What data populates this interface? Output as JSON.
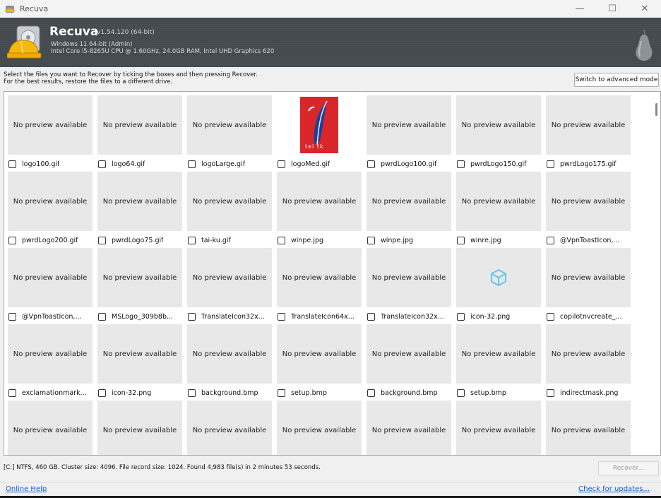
{
  "window": {
    "title": "Recuva",
    "minimize_glyph": "—",
    "maximize_glyph": "☐",
    "close_glyph": "✕"
  },
  "header": {
    "app_name": "Recuva",
    "version": "v1.54.120 (64-bit)",
    "os": "Windows 11 64-bit (Admin)",
    "hardware": "Intel Core i5-8265U CPU @ 1.60GHz, 24.0GB RAM, Intel UHD Graphics 620"
  },
  "instructions": {
    "line1": "Select the files you want to Recover by ticking the boxes and then pressing Recover.",
    "line2": "For the best results, restore the files to a different drive."
  },
  "advanced_button_label": "Switch to advanced mode",
  "no_preview_text": "No preview available",
  "image_thumb_text": "tel tk",
  "files": [
    {
      "name": "logo100.gif",
      "preview": "none"
    },
    {
      "name": "logo64.gif",
      "preview": "none"
    },
    {
      "name": "logoLarge.gif",
      "preview": "none"
    },
    {
      "name": "logoMed.gif",
      "preview": "feather"
    },
    {
      "name": "pwrdLogo100.gif",
      "preview": "none"
    },
    {
      "name": "pwrdLogo150.gif",
      "preview": "none"
    },
    {
      "name": "pwrdLogo175.gif",
      "preview": "none"
    },
    {
      "name": "pwrdLogo200.gif",
      "preview": "none"
    },
    {
      "name": "pwrdLogo75.gif",
      "preview": "none"
    },
    {
      "name": "tai-ku.gif",
      "preview": "none"
    },
    {
      "name": "winpe.jpg",
      "preview": "none"
    },
    {
      "name": "winpe.jpg",
      "preview": "none"
    },
    {
      "name": "winre.jpg",
      "preview": "none"
    },
    {
      "name": "@VpnToastIcon,...",
      "preview": "none"
    },
    {
      "name": "@VpnToastIcon,...",
      "preview": "none"
    },
    {
      "name": "MSLogo_309b8b...",
      "preview": "none"
    },
    {
      "name": "TranslateIcon32x...",
      "preview": "none"
    },
    {
      "name": "TranslateIcon64x...",
      "preview": "none"
    },
    {
      "name": "TranslateIcon32x...",
      "preview": "none"
    },
    {
      "name": "icon-32.png",
      "preview": "cube"
    },
    {
      "name": "copilotnvcreate_...",
      "preview": "none"
    },
    {
      "name": "exclamationmark...",
      "preview": "none"
    },
    {
      "name": "icon-32.png",
      "preview": "none"
    },
    {
      "name": "background.bmp",
      "preview": "none"
    },
    {
      "name": "setup.bmp",
      "preview": "none"
    },
    {
      "name": "background.bmp",
      "preview": "none"
    },
    {
      "name": "setup.bmp",
      "preview": "none"
    },
    {
      "name": "indirectmask.png",
      "preview": "none"
    },
    {
      "name": "",
      "preview": "none"
    },
    {
      "name": "",
      "preview": "none"
    },
    {
      "name": "",
      "preview": "none"
    },
    {
      "name": "",
      "preview": "none"
    },
    {
      "name": "",
      "preview": "none"
    },
    {
      "name": "",
      "preview": "none"
    },
    {
      "name": "",
      "preview": "none"
    }
  ],
  "status_text": "[C:] NTFS, 460 GB. Cluster size: 4096. File record size: 1024. Found 4,983 file(s) in 2 minutes 53 seconds.",
  "recover_button_label": "Recover...",
  "footer": {
    "online_help": "Online Help",
    "check_updates": "Check for updates..."
  },
  "colors": {
    "header_bg": "#444a4d",
    "link": "#0b5cd5",
    "thumb_bg": "#e8e8e8",
    "feather_bg": "#d9262b",
    "cube": "#5fc7f2"
  }
}
